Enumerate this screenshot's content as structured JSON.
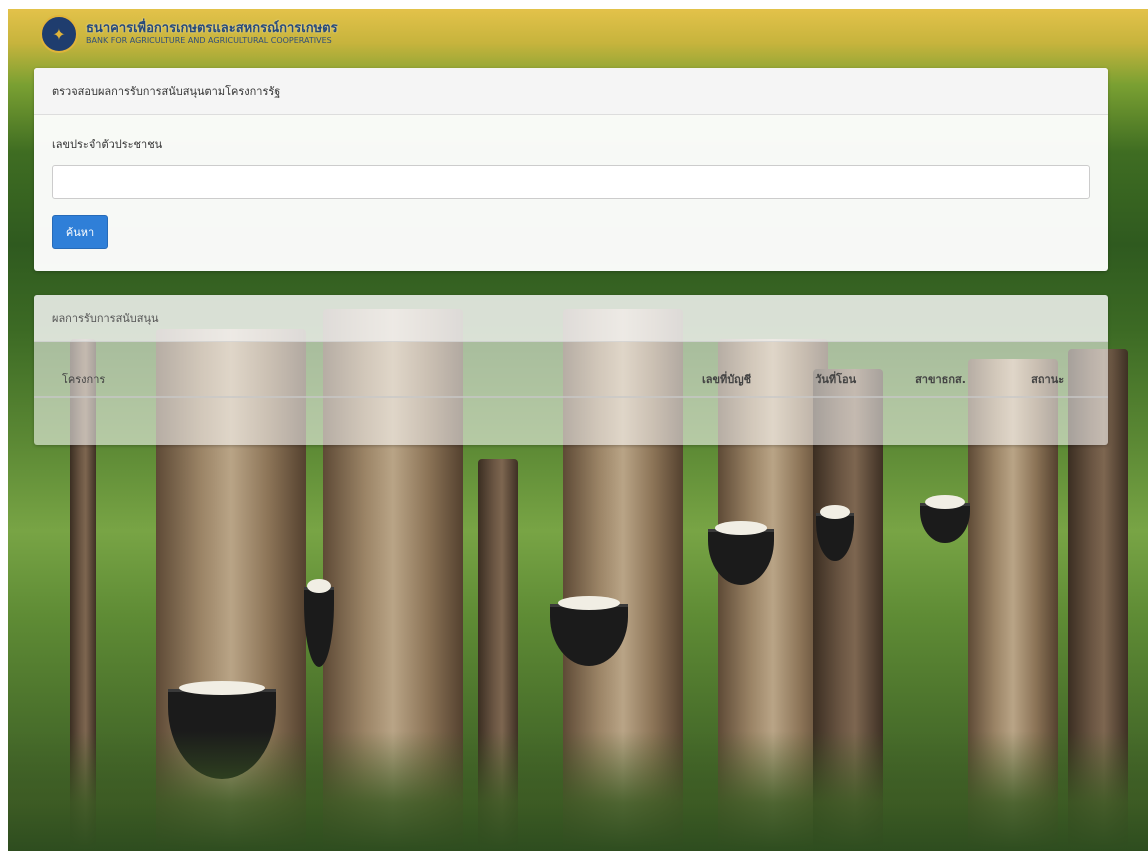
{
  "header": {
    "org_name_th": "ธนาคารเพื่อการเกษตรและสหกรณ์การเกษตร",
    "org_name_en": "BANK FOR AGRICULTURE AND AGRICULTURAL COOPERATIVES",
    "logo_icon": "baac-logo-icon"
  },
  "search": {
    "title": "ตรวจสอบผลการรับการสนับสนุนตามโครงการรัฐ",
    "id_label": "เลขประจำตัวประชาชน",
    "id_value": "",
    "id_placeholder": "",
    "submit_label": "ค้นหา",
    "accent_color": "#2f7fd8"
  },
  "results": {
    "title": "ผลการรับการสนับสนุน",
    "columns": [
      "โครงการ",
      "เลขที่บัญชี",
      "วันที่โอน",
      "สาขาธกส.",
      "สถานะ"
    ],
    "rows": []
  }
}
